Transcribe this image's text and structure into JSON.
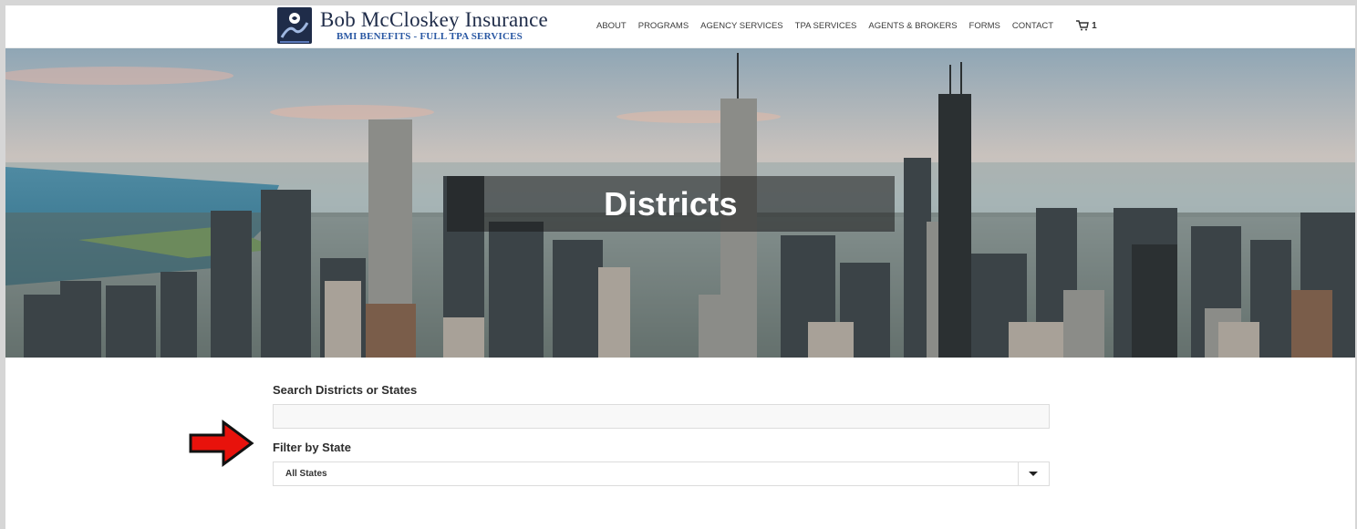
{
  "brand": {
    "name": "Bob McCloskey Insurance",
    "tagline": "BMI BENEFITS - FULL TPA SERVICES"
  },
  "nav": {
    "items": [
      "ABOUT",
      "PROGRAMS",
      "AGENCY SERVICES",
      "TPA SERVICES",
      "AGENTS & BROKERS",
      "FORMS",
      "CONTACT"
    ],
    "cart_count": "1"
  },
  "hero": {
    "title": "Districts"
  },
  "search": {
    "label": "Search Districts or States",
    "value": "",
    "placeholder": ""
  },
  "filter": {
    "label": "Filter by State",
    "selected": "All States"
  },
  "colors": {
    "accent_red": "#e8120c",
    "logo_navy": "#1f2c49",
    "logo_blue": "#2a58a3"
  }
}
